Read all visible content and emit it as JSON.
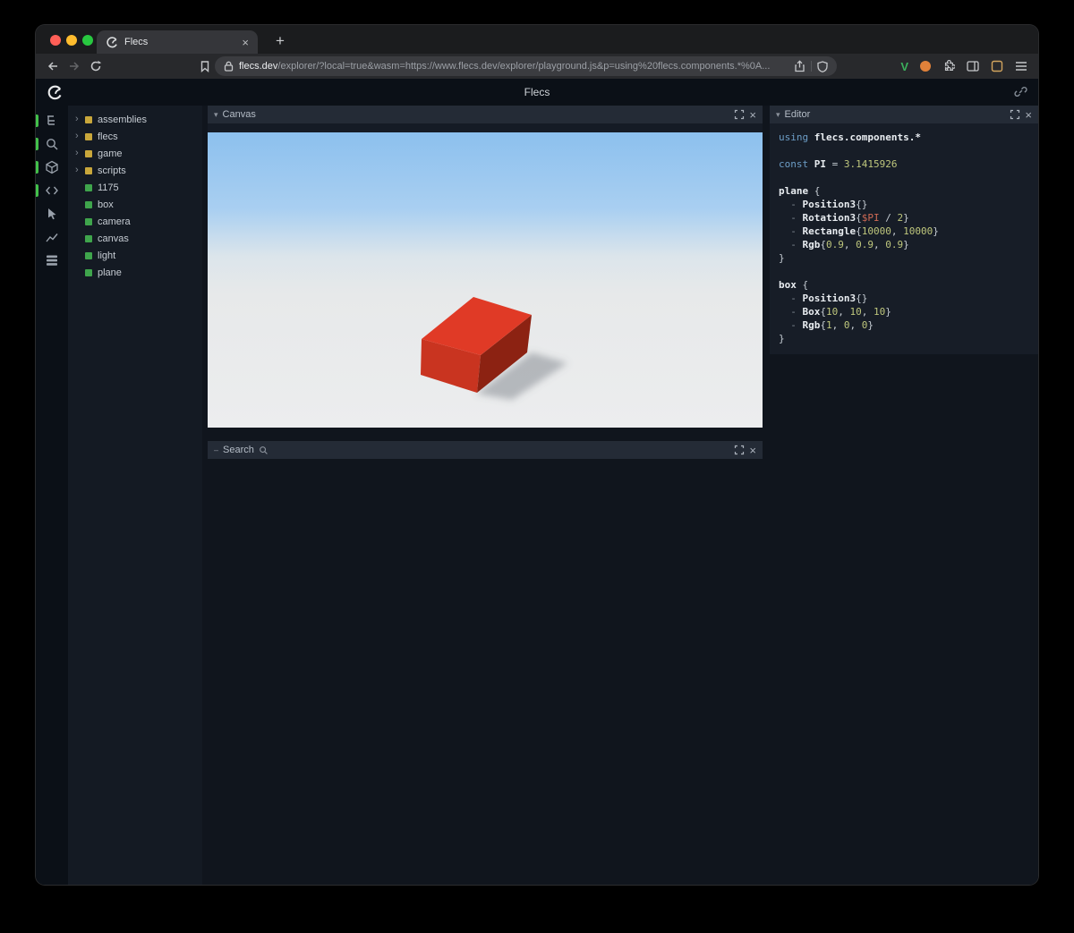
{
  "browser": {
    "traffic_lights": [
      "#ff5f57",
      "#febc2e",
      "#28c840"
    ],
    "tab": {
      "title": "Flecs"
    },
    "new_tab": "+",
    "url": {
      "domain": "flecs.dev",
      "rest": "/explorer/?local=true&wasm=https://www.flecs.dev/explorer/playground.js&p=using%20flecs.components.*%0A..."
    },
    "extensions": {
      "v_label": "V"
    }
  },
  "app": {
    "title": "Flecs"
  },
  "icons": {
    "close": "×",
    "chevron_down": "▾",
    "chevron_right": "›",
    "dash": "–",
    "plus": "+"
  },
  "colors": {
    "accent": "#43c04a",
    "module": "#c9a73b",
    "entity": "#3fa54c"
  },
  "sidebar": {
    "icons": [
      {
        "name": "hierarchy",
        "active": true
      },
      {
        "name": "search",
        "active": true
      },
      {
        "name": "scene",
        "active": true
      },
      {
        "name": "code",
        "active": true
      },
      {
        "name": "inspector",
        "active": false
      },
      {
        "name": "stats",
        "active": false
      },
      {
        "name": "memory",
        "active": false
      }
    ]
  },
  "tree": {
    "items": [
      {
        "label": "assemblies",
        "kind": "module"
      },
      {
        "label": "flecs",
        "kind": "module"
      },
      {
        "label": "game",
        "kind": "module"
      },
      {
        "label": "scripts",
        "kind": "module"
      },
      {
        "label": "1175",
        "kind": "entity"
      },
      {
        "label": "box",
        "kind": "entity"
      },
      {
        "label": "camera",
        "kind": "entity"
      },
      {
        "label": "canvas",
        "kind": "entity"
      },
      {
        "label": "light",
        "kind": "entity"
      },
      {
        "label": "plane",
        "kind": "entity"
      }
    ]
  },
  "panels": {
    "canvas": {
      "title": "Canvas"
    },
    "search": {
      "title": "Search"
    },
    "editor": {
      "title": "Editor"
    }
  },
  "scene": {
    "sky_top": "#8cc0ee",
    "sky_mid": "#a9cff1",
    "horizon": "#dce5eb",
    "ground_near": "#e7e9ea",
    "ground_far": "#ecedee",
    "box_top": "#e03a26",
    "box_front": "#c93420",
    "box_side": "#8c2212",
    "shadow": "#6a7076"
  },
  "editor": {
    "lines": [
      [
        [
          "using",
          "kw"
        ],
        [
          " ",
          "plain"
        ],
        [
          "flecs.components.*",
          "comp"
        ]
      ],
      [],
      [
        [
          "const",
          "kw"
        ],
        [
          " ",
          "plain"
        ],
        [
          "PI",
          "comp"
        ],
        [
          " = ",
          "plain"
        ],
        [
          "3.1415926",
          "num"
        ]
      ],
      [],
      [
        [
          "plane",
          "ent"
        ],
        [
          " {",
          "plain"
        ]
      ],
      [
        [
          "  - ",
          "dash"
        ],
        [
          "Position3",
          "comp"
        ],
        [
          "{}",
          "plain"
        ]
      ],
      [
        [
          "  - ",
          "dash"
        ],
        [
          "Rotation3",
          "comp"
        ],
        [
          "{",
          "plain"
        ],
        [
          "$PI",
          "var"
        ],
        [
          " / ",
          "plain"
        ],
        [
          "2",
          "num"
        ],
        [
          "}",
          "plain"
        ]
      ],
      [
        [
          "  - ",
          "dash"
        ],
        [
          "Rectangle",
          "comp"
        ],
        [
          "{",
          "plain"
        ],
        [
          "10000",
          "num"
        ],
        [
          ", ",
          "plain"
        ],
        [
          "10000",
          "num"
        ],
        [
          "}",
          "plain"
        ]
      ],
      [
        [
          "  - ",
          "dash"
        ],
        [
          "Rgb",
          "comp"
        ],
        [
          "{",
          "plain"
        ],
        [
          "0.9",
          "num"
        ],
        [
          ", ",
          "plain"
        ],
        [
          "0.9",
          "num"
        ],
        [
          ", ",
          "plain"
        ],
        [
          "0.9",
          "num"
        ],
        [
          "}",
          "plain"
        ]
      ],
      [
        [
          "}",
          "plain"
        ]
      ],
      [],
      [
        [
          "box",
          "ent"
        ],
        [
          " {",
          "plain"
        ]
      ],
      [
        [
          "  - ",
          "dash"
        ],
        [
          "Position3",
          "comp"
        ],
        [
          "{}",
          "plain"
        ]
      ],
      [
        [
          "  - ",
          "dash"
        ],
        [
          "Box",
          "comp"
        ],
        [
          "{",
          "plain"
        ],
        [
          "10",
          "num"
        ],
        [
          ", ",
          "plain"
        ],
        [
          "10",
          "num"
        ],
        [
          ", ",
          "plain"
        ],
        [
          "10",
          "num"
        ],
        [
          "}",
          "plain"
        ]
      ],
      [
        [
          "  - ",
          "dash"
        ],
        [
          "Rgb",
          "comp"
        ],
        [
          "{",
          "plain"
        ],
        [
          "1",
          "num"
        ],
        [
          ", ",
          "plain"
        ],
        [
          "0",
          "num"
        ],
        [
          ", ",
          "plain"
        ],
        [
          "0",
          "num"
        ],
        [
          "}",
          "plain"
        ]
      ],
      [
        [
          "}",
          "plain"
        ]
      ]
    ]
  }
}
